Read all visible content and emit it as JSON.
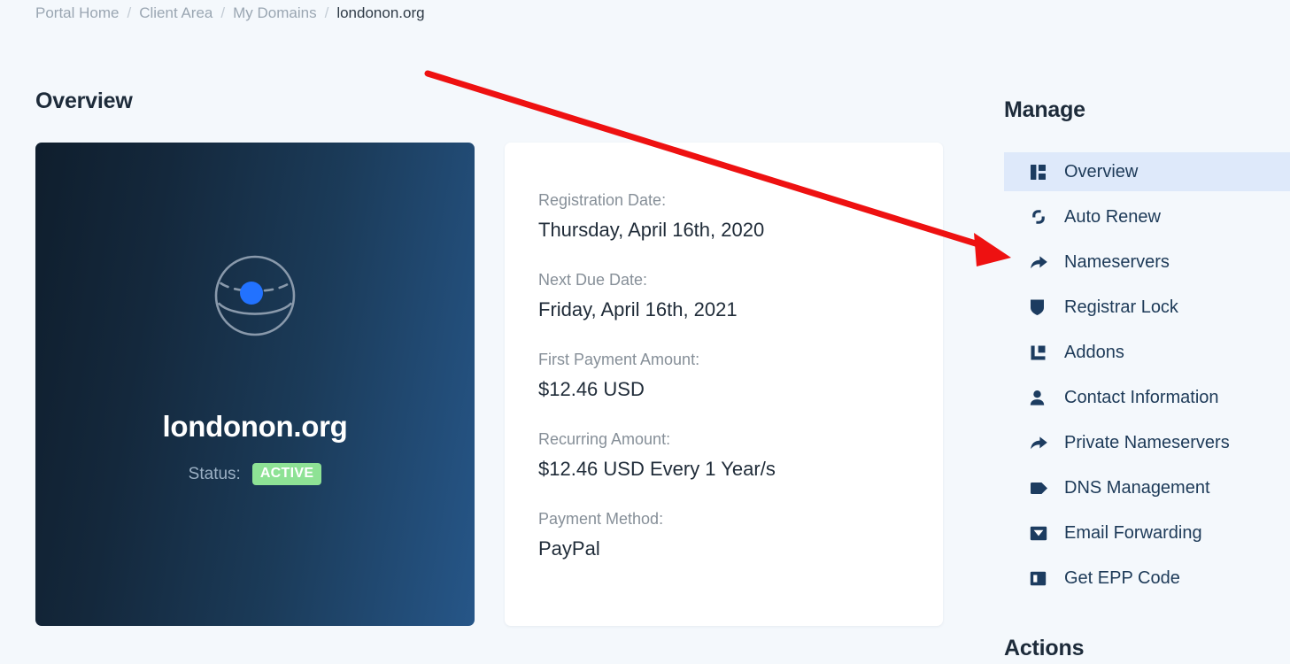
{
  "breadcrumb": {
    "items": [
      {
        "label": "Portal Home",
        "current": false
      },
      {
        "label": "Client Area",
        "current": false
      },
      {
        "label": "My Domains",
        "current": false
      },
      {
        "label": "londonon.org",
        "current": true
      }
    ],
    "separator": "/"
  },
  "main": {
    "section_title": "Overview",
    "domain_card": {
      "icon": "globe-icon",
      "domain_name": "londonon.org",
      "status_label": "Status:",
      "status_value": "ACTIVE",
      "status_color": "#8ee295"
    },
    "details": [
      {
        "label": "Registration Date:",
        "value": "Thursday, April 16th, 2020"
      },
      {
        "label": "Next Due Date:",
        "value": "Friday, April 16th, 2021"
      },
      {
        "label": "First Payment Amount:",
        "value": "$12.46 USD"
      },
      {
        "label": "Recurring Amount:",
        "value": "$12.46 USD Every 1 Year/s"
      },
      {
        "label": "Payment Method:",
        "value": "PayPal"
      }
    ]
  },
  "sidebar": {
    "manage_heading": "Manage",
    "actions_heading": "Actions",
    "active_highlight_color": "#dee9fa",
    "items": [
      {
        "label": "Overview",
        "icon": "layout-columns-icon",
        "active": true
      },
      {
        "label": "Auto Renew",
        "icon": "sync-icon",
        "active": false
      },
      {
        "label": "Nameservers",
        "icon": "forward-arrow-icon",
        "active": false
      },
      {
        "label": "Registrar Lock",
        "icon": "shield-icon",
        "active": false
      },
      {
        "label": "Addons",
        "icon": "addons-icon",
        "active": false
      },
      {
        "label": "Contact Information",
        "icon": "person-icon",
        "active": false
      },
      {
        "label": "Private Nameservers",
        "icon": "forward-arrow-icon",
        "active": false
      },
      {
        "label": "DNS Management",
        "icon": "tag-icon",
        "active": false
      },
      {
        "label": "Email Forwarding",
        "icon": "envelope-icon",
        "active": false
      },
      {
        "label": "Get EPP Code",
        "icon": "code-box-icon",
        "active": false
      }
    ]
  },
  "annotation": {
    "arrow_color": "#ee1111",
    "points_to": "Nameservers"
  }
}
